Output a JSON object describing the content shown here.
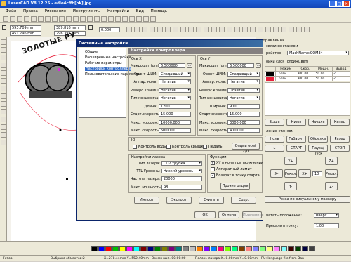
{
  "window": {
    "title": "LaserCAD V8.12.25 - edle4cffb[ok].jpg",
    "min": "_",
    "max": "□",
    "close": "×"
  },
  "menu": [
    "Файл",
    "Правка",
    "Рисование",
    "Инструменты",
    "Настройки",
    "Вид",
    "Помощь"
  ],
  "coords": {
    "x": "593.709 mm",
    "y": "451.796 mm",
    "w": "389.816 mm",
    "h": "296.397 mm",
    "angle": "0.000",
    "unit_x": "mm",
    "unit_y": "mm"
  },
  "canvas_text": "ЗОЛОТЫЕ РУ",
  "right_panel": {
    "title": "управления",
    "conn_label": "связи со станком",
    "port_label": "ройство",
    "port_value": "MachName:COM34",
    "layers_label": "ойки слоя (слой+цвет)",
    "headers": [
      "Режим",
      "Скор.",
      "Мощн.",
      "Вывод"
    ],
    "rows": [
      {
        "mode": "Грави...",
        "speed": "300.00",
        "power": "50.00",
        "out": "✓",
        "color": "#000000"
      },
      {
        "mode": "Грави...",
        "speed": "300.00",
        "power": "50.00",
        "out": "✓",
        "color": "#e8203a"
      }
    ],
    "row_buttons": [
      "Выше",
      "Ниже",
      "Начало",
      "Конец"
    ],
    "machine_label": "ление станком",
    "mbuttons1": [
      "Ноль",
      "Габарит",
      "Обрезка",
      "Разер"
    ],
    "mbuttons2": [
      "ь",
      "СТАРТ",
      "Пауза/Пуск",
      "СТОП"
    ],
    "jog": {
      "yp": "Y+",
      "ym": "Y-",
      "xm": "X-",
      "xp": "X+",
      "zp": "Z+",
      "zm": "Z-",
      "pos1": "Рекал.",
      "pos2": "Рекал.",
      "step_val": "10"
    },
    "align_btn": "Резка по визуальному маркеру",
    "pos_label1": "чатать положение:",
    "pos_val1": "Вверх",
    "pos_label2": "Прекали в точку:",
    "pos_val2": "1.00"
  },
  "dialog": {
    "title": "Системные настройки",
    "tree": [
      "Общие",
      "Расширенные настройки",
      "Рабочие параметры",
      "Настройки контроллера",
      "Пользовательские параметры"
    ],
    "selected_index": 3,
    "panel_title": "Настройки контроллера",
    "x_axis": {
      "header": "Ось X",
      "fields": [
        {
          "label": "Микрошаг (um):",
          "value": "6.500000",
          "kind": "input",
          "dots": true
        },
        {
          "label": "Фронт ШИМ:",
          "value": "Спадающий",
          "kind": "select"
        },
        {
          "label": "Аппар. ноль:",
          "value": "Негатив",
          "kind": "select"
        },
        {
          "label": "Реверс клавиш:",
          "value": "Негатив",
          "kind": "select"
        },
        {
          "label": "Тип концевика:",
          "value": "Негатив",
          "kind": "select"
        },
        {
          "label": "Длина:",
          "value": "1200",
          "kind": "input"
        },
        {
          "label": "Старт.скорость:",
          "value": "15.000",
          "kind": "input"
        },
        {
          "label": "Макс. ускорен.:",
          "value": "10000.000",
          "kind": "input"
        },
        {
          "label": "Макс. скорость:",
          "value": "500.000",
          "kind": "input"
        }
      ]
    },
    "y_axis": {
      "header": "Ось Y",
      "fields": [
        {
          "label": "Микрошаг (um):",
          "value": "6.500000",
          "kind": "input",
          "dots": true
        },
        {
          "label": "Фронт ШИМ:",
          "value": "Спадающий",
          "kind": "select"
        },
        {
          "label": "Аппар. ноль:",
          "value": "Негатив",
          "kind": "select"
        },
        {
          "label": "Реверс клавиш:",
          "value": "Позитив",
          "kind": "select"
        },
        {
          "label": "Тип концевика:",
          "value": "Негатив",
          "kind": "select"
        },
        {
          "label": "Ширина:",
          "value": "900",
          "kind": "input"
        },
        {
          "label": "Старт.скорость:",
          "value": "15.000",
          "kind": "input"
        },
        {
          "label": "Макс. ускорен.:",
          "value": "3000.000",
          "kind": "input"
        },
        {
          "label": "Макс. скорость:",
          "value": "400.000",
          "kind": "input"
        }
      ]
    },
    "io": {
      "header": "IO",
      "water": "Контроль воды",
      "lid": "Контроль крышки",
      "pedal": "Педаль",
      "opts_btn": "Опции осей Z/U"
    },
    "laser": {
      "header": "Настройки лазера",
      "type_label": "Тип лазера:",
      "type_value": "CO2 трубка",
      "ttl_label": "TTL Уровень:",
      "ttl_value": "Низкий уровень",
      "freq_label": "Частота лазера:",
      "freq_value": "20000",
      "power_label": "Макс. мощность:",
      "power_value": "98"
    },
    "functions": {
      "header": "Функции",
      "items": [
        {
          "label": "XY в ноль при включении",
          "checked": true
        },
        {
          "label": "Аппаратный лимит",
          "checked": false
        },
        {
          "label": "Возврат в точку старта",
          "checked": true
        }
      ],
      "more_btn": "Прочие опции"
    },
    "action_buttons": [
      "Импорт",
      "Экспорт",
      "Считать",
      "Сохр."
    ],
    "footer_buttons": [
      "OK",
      "Отмена",
      "Применить"
    ]
  },
  "status": {
    "s1": "Готов",
    "s2": "Выбрано объектов:2",
    "s3": "X=278.44mm Y=552.40mm",
    "s4": "Время вып.:00:00:00",
    "s5": "Полож. лазера:X=0.00mm Y=0.00mm",
    "s6": "RU: language file from Dan"
  },
  "palette": [
    "#000000",
    "#0000ff",
    "#ff0000",
    "#00c000",
    "#ffff00",
    "#ff00ff",
    "#00ffff",
    "#800000",
    "#000080",
    "#008000",
    "#808000",
    "#800080",
    "#008080",
    "#808080",
    "#c0c0c0",
    "#ff8000",
    "#8000ff",
    "#0080ff",
    "#ff0080",
    "#80ff00",
    "#00ff80",
    "#804000",
    "#ff8080",
    "#8080ff",
    "#80ff80",
    "#ffff80",
    "#ff80ff",
    "#80ffff",
    "#400000",
    "#004000",
    "#000040",
    "#404040"
  ]
}
